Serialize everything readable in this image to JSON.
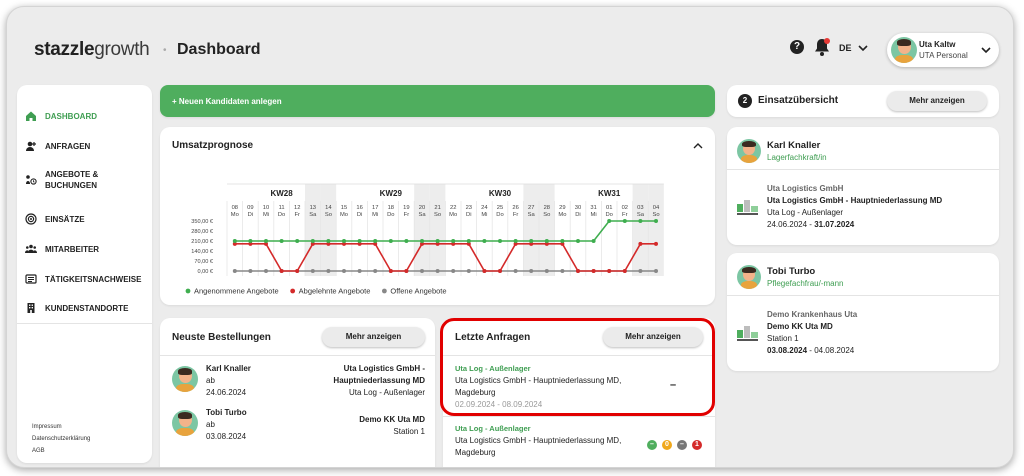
{
  "header": {
    "logo_bold": "stazzle",
    "logo_light": "growth",
    "separator": "•",
    "title": "Dashboard",
    "help": "?",
    "lang": "DE",
    "user_name": "Uta Kaltw",
    "user_role": "UTA Personal"
  },
  "sidebar": {
    "items": [
      {
        "label": "DASHBOARD",
        "icon": "home-icon",
        "active": true
      },
      {
        "label": "ANFRAGEN",
        "icon": "user-plus-icon"
      },
      {
        "label": "ANGEBOTE &",
        "label2": "BUCHUNGEN",
        "icon": "booking-icon"
      },
      {
        "label": "EINSÄTZE",
        "icon": "target-icon"
      },
      {
        "label": "MITARBEITER",
        "icon": "team-icon"
      },
      {
        "label": "TÄTIGKEITSNACHWEISE",
        "icon": "list-icon"
      },
      {
        "label": "KUNDENSTANDORTE",
        "icon": "building-icon"
      }
    ],
    "footer": [
      "Impressum",
      "Datenschutzerklärung",
      "AGB"
    ]
  },
  "new_candidates": "+ Neuen Kandidaten anlegen",
  "forecast": {
    "title": "Umsatzprognose"
  },
  "chart_data": {
    "type": "line",
    "title": "Umsatzprognose",
    "weeks": [
      {
        "label": "KW28",
        "start": 0
      },
      {
        "label": "KW29",
        "start": 7
      },
      {
        "label": "KW30",
        "start": 14
      },
      {
        "label": "KW31",
        "start": 21
      }
    ],
    "days": [
      "08",
      "09",
      "10",
      "11",
      "12",
      "13",
      "14",
      "15",
      "16",
      "17",
      "18",
      "19",
      "20",
      "21",
      "22",
      "23",
      "24",
      "25",
      "26",
      "27",
      "28",
      "29",
      "30",
      "31",
      "01",
      "02",
      "03",
      "04"
    ],
    "weekdays": [
      "Mo",
      "Di",
      "Mi",
      "Do",
      "Fr",
      "Sa",
      "So",
      "Mo",
      "Di",
      "Mi",
      "Do",
      "Fr",
      "Sa",
      "So",
      "Mo",
      "Di",
      "Mi",
      "Do",
      "Fr",
      "Sa",
      "So",
      "Mo",
      "Di",
      "Mi",
      "Do",
      "Fr",
      "Sa",
      "So"
    ],
    "yticks": [
      "350,00 €",
      "280,00 €",
      "210,00 €",
      "140,00 €",
      "70,00 €",
      "0,00 €"
    ],
    "ylim": [
      0,
      350
    ],
    "series": [
      {
        "name": "Angenommene Angebote",
        "color": "#3fae4f",
        "values": [
          210,
          210,
          210,
          210,
          210,
          210,
          210,
          210,
          210,
          210,
          210,
          210,
          210,
          210,
          210,
          210,
          210,
          210,
          210,
          210,
          210,
          210,
          210,
          210,
          350,
          350,
          350,
          350
        ]
      },
      {
        "name": "Abgelehnte Angebote",
        "color": "#d42a2a",
        "values": [
          190,
          190,
          190,
          0,
          0,
          190,
          190,
          190,
          190,
          190,
          0,
          0,
          190,
          190,
          190,
          190,
          0,
          0,
          190,
          190,
          190,
          190,
          0,
          0,
          0,
          0,
          190,
          190
        ]
      },
      {
        "name": "Offene Angebote",
        "color": "#888888",
        "values": [
          0,
          0,
          0,
          0,
          0,
          0,
          0,
          0,
          0,
          0,
          0,
          0,
          0,
          0,
          0,
          0,
          0,
          0,
          0,
          0,
          0,
          0,
          0,
          0,
          0,
          0,
          0,
          0
        ]
      }
    ],
    "legend": "bottom-left"
  },
  "orders": {
    "title": "Neuste Bestellungen",
    "more": "Mehr anzeigen",
    "rows": [
      {
        "name": "Karl Knaller",
        "sub": "ab",
        "date": "24.06.2024",
        "company": "Uta Logistics GmbH -",
        "company2": "Hauptniederlassung MD",
        "site": "Uta Log - Außenlager"
      },
      {
        "name": "Tobi Turbo",
        "sub": "ab",
        "date": "03.08.2024",
        "company": "Demo KK Uta MD",
        "company2": "",
        "site": "Station 1"
      }
    ]
  },
  "requests": {
    "title": "Letzte Anfragen",
    "more": "Mehr anzeigen",
    "rows": [
      {
        "title": "Uta Log - Außenlager",
        "addr1": "Uta Logistics GmbH - Hauptniederlassung MD,",
        "addr2": "Magdeburg",
        "dates": "02.09.2024 - 08.09.2024",
        "status": "–"
      },
      {
        "title": "Uta Log - Außenlager",
        "addr1": "Uta Logistics GmbH - Hauptniederlassung MD,",
        "addr2": "Magdeburg",
        "badges": [
          {
            "t": "–",
            "c": "#4fae5e"
          },
          {
            "t": "0",
            "c": "#f0a81c"
          },
          {
            "t": "–",
            "c": "#777777"
          },
          {
            "t": "1",
            "c": "#d42a2a"
          }
        ]
      }
    ]
  },
  "overview": {
    "count": "2",
    "title": "Einsatzübersicht",
    "more": "Mehr anzeigen",
    "cards": [
      {
        "name": "Karl Knaller",
        "role": "Lagerfachkraft/in",
        "company": "Uta Logistics GmbH",
        "site": "Uta Logistics GmbH - Hauptniederlassung MD",
        "loc": "Uta Log - Außenlager",
        "from": "24.06.2024",
        "dash": "-",
        "to": "31.07.2024"
      },
      {
        "name": "Tobi Turbo",
        "role": "Pflegefachfrau/-mann",
        "company": "Demo Krankenhaus Uta",
        "site": "Demo KK Uta MD",
        "loc": "Station 1",
        "from": "03.08.2024",
        "dash": "-",
        "to": "04.08.2024"
      }
    ]
  }
}
